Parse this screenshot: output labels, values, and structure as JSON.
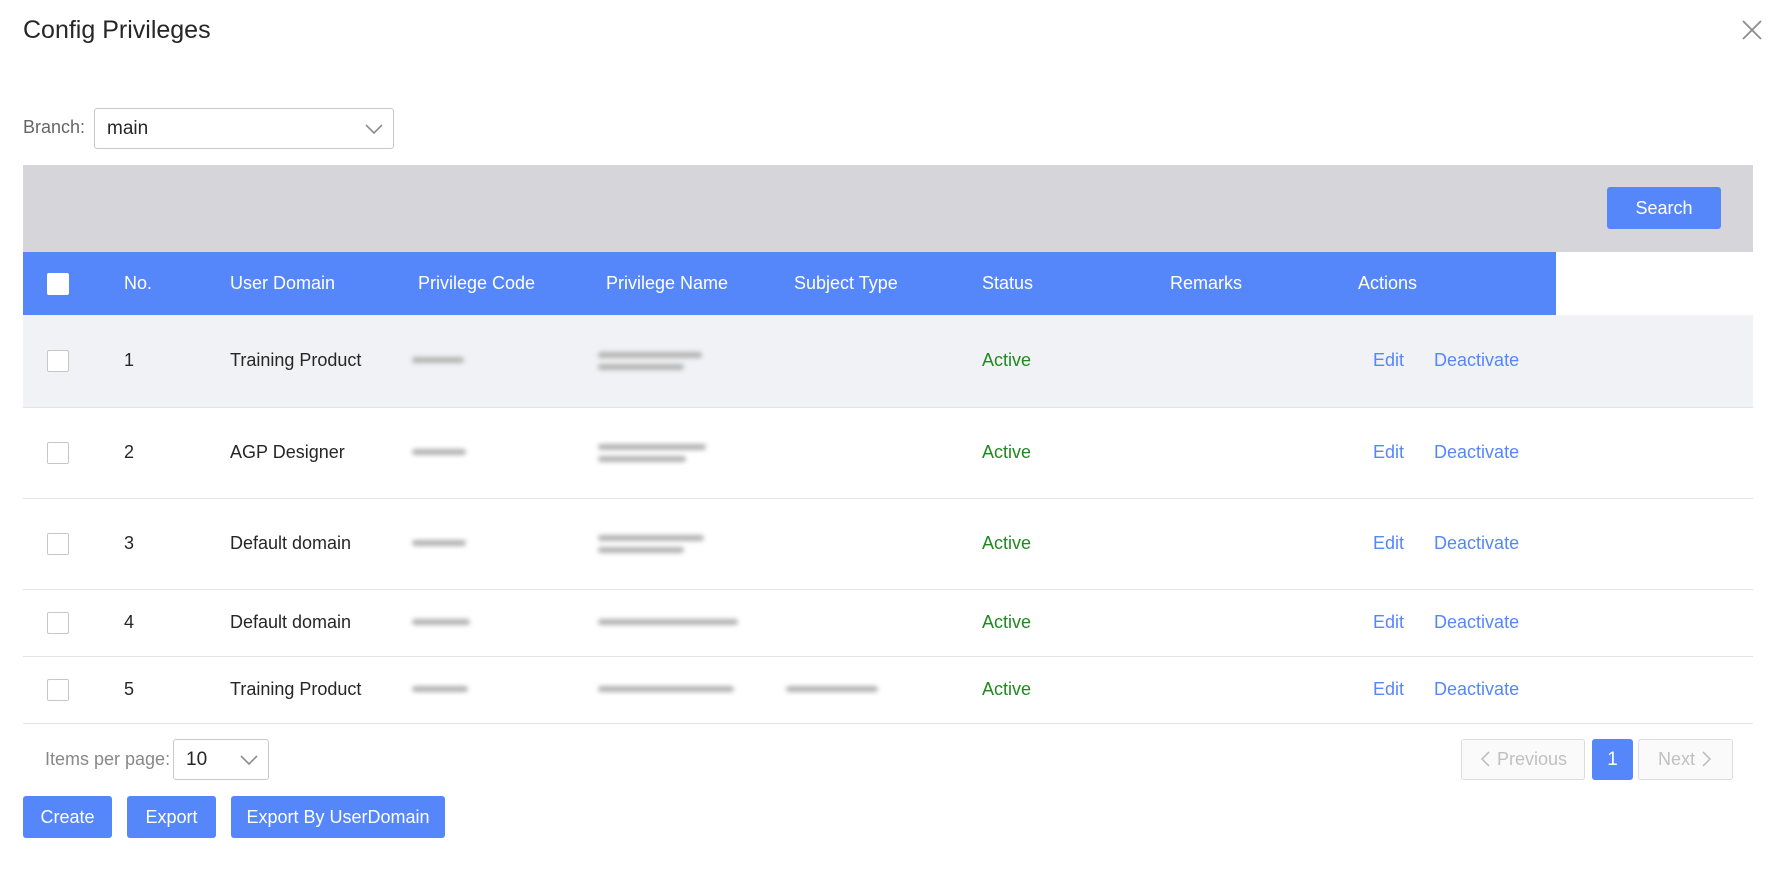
{
  "dialog": {
    "title": "Config Privileges",
    "close_icon": "close-icon"
  },
  "filter": {
    "branch_label": "Branch:",
    "branch_value": "main"
  },
  "search": {
    "button_label": "Search"
  },
  "table": {
    "columns": [
      "No.",
      "User Domain",
      "Privilege Code",
      "Privilege Name",
      "Subject Type",
      "Status",
      "Remarks",
      "Actions"
    ],
    "rows": [
      {
        "no": "1",
        "user_domain": "Training Product",
        "status": "Active",
        "edit": "Edit",
        "deactivate": "Deactivate"
      },
      {
        "no": "2",
        "user_domain": "AGP Designer",
        "status": "Active",
        "edit": "Edit",
        "deactivate": "Deactivate"
      },
      {
        "no": "3",
        "user_domain": "Default domain",
        "status": "Active",
        "edit": "Edit",
        "deactivate": "Deactivate"
      },
      {
        "no": "4",
        "user_domain": "Default domain",
        "status": "Active",
        "edit": "Edit",
        "deactivate": "Deactivate"
      },
      {
        "no": "5",
        "user_domain": "Training Product",
        "status": "Active",
        "edit": "Edit",
        "deactivate": "Deactivate"
      }
    ]
  },
  "pagination": {
    "items_per_page_label": "Items per page:",
    "items_per_page_value": "10",
    "previous_label": "Previous",
    "next_label": "Next",
    "current_page": "1"
  },
  "footer": {
    "create_label": "Create",
    "export_label": "Export",
    "export_by_domain_label": "Export By UserDomain"
  },
  "colors": {
    "accent": "#5586fa",
    "status_active": "#1e8a1e",
    "search_band": "#d6d6da"
  }
}
